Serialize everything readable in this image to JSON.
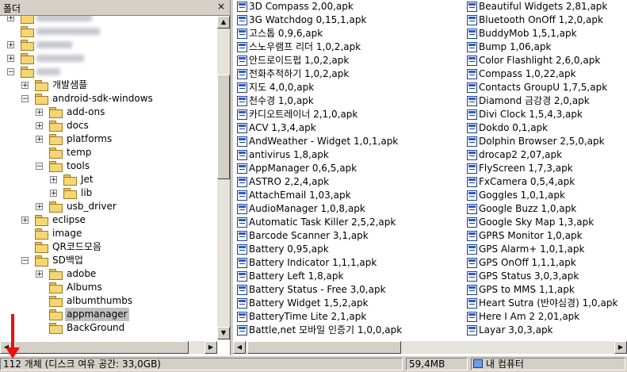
{
  "left_pane": {
    "header_title": "폴더",
    "close_glyph": "×",
    "tree": [
      {
        "label": "",
        "depth": 0,
        "exp": "+",
        "blur": 70
      },
      {
        "label": "",
        "depth": 0,
        "exp": "",
        "blur": 80
      },
      {
        "label": "",
        "depth": 0,
        "exp": "+",
        "blur": 45
      },
      {
        "label": "",
        "depth": 0,
        "exp": "+",
        "blur": 60
      },
      {
        "label": "",
        "depth": 0,
        "exp": "-",
        "blur": 30
      },
      {
        "label": "개발샘플",
        "depth": 1,
        "exp": "+"
      },
      {
        "label": "android-sdk-windows",
        "depth": 1,
        "exp": "-"
      },
      {
        "label": "add-ons",
        "depth": 2,
        "exp": "+"
      },
      {
        "label": "docs",
        "depth": 2,
        "exp": "+"
      },
      {
        "label": "platforms",
        "depth": 2,
        "exp": "+"
      },
      {
        "label": "temp",
        "depth": 2,
        "exp": ""
      },
      {
        "label": "tools",
        "depth": 2,
        "exp": "-"
      },
      {
        "label": "Jet",
        "depth": 3,
        "exp": "+"
      },
      {
        "label": "lib",
        "depth": 3,
        "exp": "+"
      },
      {
        "label": "usb_driver",
        "depth": 2,
        "exp": "+"
      },
      {
        "label": "eclipse",
        "depth": 1,
        "exp": "+"
      },
      {
        "label": "image",
        "depth": 1,
        "exp": ""
      },
      {
        "label": "QR코드모음",
        "depth": 1,
        "exp": ""
      },
      {
        "label": "SD백업",
        "depth": 1,
        "exp": "-"
      },
      {
        "label": "adobe",
        "depth": 2,
        "exp": "+"
      },
      {
        "label": "Albums",
        "depth": 2,
        "exp": ""
      },
      {
        "label": "albumthumbs",
        "depth": 2,
        "exp": ""
      },
      {
        "label": "appmanager",
        "depth": 2,
        "exp": "",
        "selected": true
      },
      {
        "label": "BackGround",
        "depth": 2,
        "exp": ""
      }
    ]
  },
  "files": {
    "column1": [
      "3D Compass 2,00,apk",
      "3G Watchdog 0,15,1,apk",
      "고스톱 0,9,6,apk",
      "스노우램프 리더 1,0,2,apk",
      "안드로이드펍 1,0,2,apk",
      "전화추적하기 1,0,2,apk",
      "지도 4,0,0,apk",
      "천수경 1,0,apk",
      "카디오트레이너 2,1,0,apk",
      "ACV 1,3,4,apk",
      "AndWeather - Widget 1,0,1,apk",
      "antivirus 1,8,apk",
      "AppManager 0,6,5,apk",
      "ASTRO 2,2,4,apk",
      "AttachEmail 1,03,apk",
      "AudioManager 1,0,8,apk",
      "Automatic Task Killer 2,5,2,apk",
      "Barcode Scanner 3,1,apk",
      "Battery 0,95,apk",
      "Battery Indicator 1,1,1,apk",
      "Battery Left 1,8,apk",
      "Battery Status - Free 3,0,apk",
      "Battery Widget 1,5,2,apk",
      "BatteryTime Lite 2,1,apk",
      "Battle,net 모바일 인증기 1,0,0,apk"
    ],
    "column2": [
      "Beautiful Widgets 2,81,apk",
      "Bluetooth OnOff 1,2,0,apk",
      "BuddyMob 1,5,1,apk",
      "Bump 1,06,apk",
      "Color Flashlight 2,6,0,apk",
      "Compass 1,0,22,apk",
      "Contacts GroupU 1,7,5,apk",
      "Diamond 금강경 2,0,apk",
      "Divi Clock 1,5,4,3,apk",
      "Dokdo 0,1,apk",
      "Dolphin Browser 2,5,0,apk",
      "drocap2 2,07,apk",
      "FlyScreen 1,7,3,apk",
      "FxCamera 0,5,4,apk",
      "Goggles 1,0,1,apk",
      "Google Buzz 1,0,apk",
      "Google Sky Map 1,3,apk",
      "GPRS Monitor 1,0,apk",
      "GPS Alarm+ 1,0,1,apk",
      "GPS OnOff 1,1,1,apk",
      "GPS Status 3,0,3,apk",
      "GPS to MMS 1,1,apk",
      "Heart Sutra (반야심경) 1,0,apk",
      "Here I Am 2 2,01,apk",
      "Layar 3,0,3,apk"
    ]
  },
  "status_bar": {
    "objects": "112 개체 (디스크 여유 공간: 33,0GB)",
    "size": "59,4MB",
    "location": "내 컴퓨터"
  },
  "colors": {
    "annotation_arrow": "#e8120c",
    "selection": "#c0c0c0"
  }
}
